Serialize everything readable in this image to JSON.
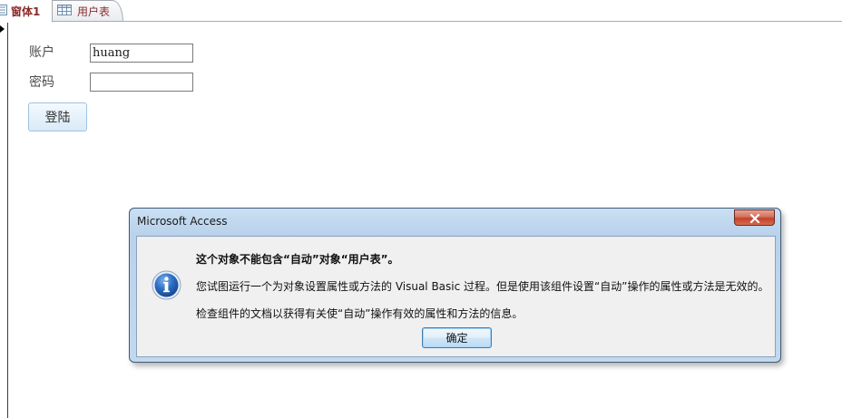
{
  "tabs": [
    {
      "label": "窗体1",
      "icon": "form-icon",
      "active": true
    },
    {
      "label": "用户表",
      "icon": "table-icon",
      "active": false
    }
  ],
  "form": {
    "account_label": "账户",
    "account_value": "huang",
    "password_label": "密码",
    "password_value": "",
    "login_button": "登陆"
  },
  "dialog": {
    "title": "Microsoft Access",
    "close_icon": "close-icon",
    "icon": "info-icon",
    "headline": "这个对象不能包含“自动”对象“用户表”。",
    "message": "您试图运行一个为对象设置属性或方法的 Visual Basic 过程。但是使用该组件设置“自动”操作的属性或方法是无效的。",
    "hint": "检查组件的文档以获得有关使“自动”操作有效的属性和方法的信息。",
    "ok_button": "确定"
  },
  "colors": {
    "tab_active_text": "#8b2b2b",
    "dialog_frame": "#c2d9ef",
    "close_button": "#c2422a",
    "info_icon_blue": "#1f5fb8"
  }
}
